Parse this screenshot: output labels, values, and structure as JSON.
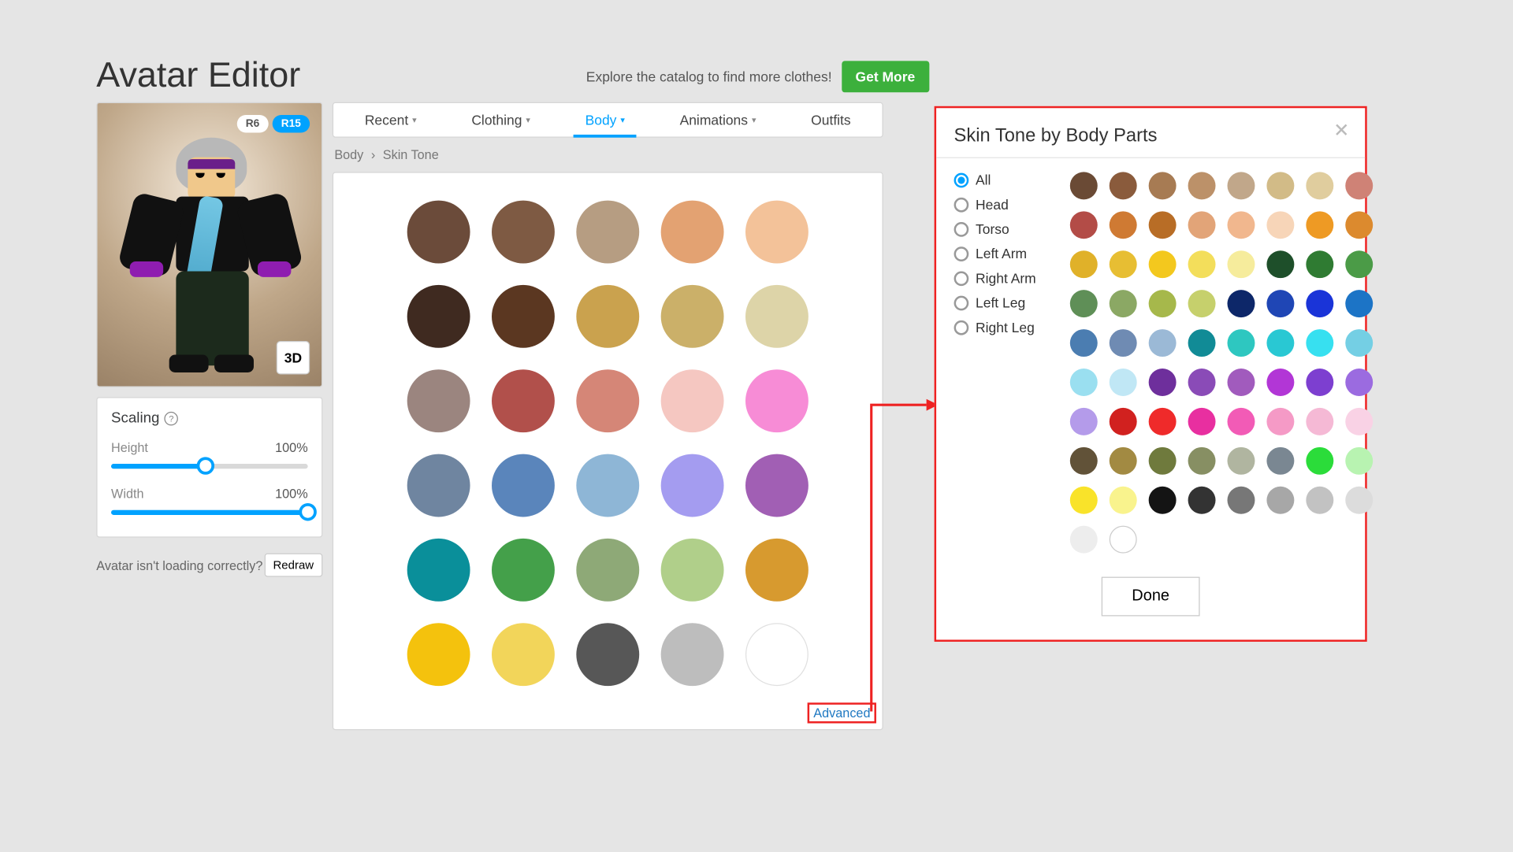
{
  "title": "Avatar Editor",
  "cta_text": "Explore the catalog to find more clothes!",
  "cta_button": "Get More",
  "rig": {
    "r6": "R6",
    "r15": "R15"
  },
  "three_d": "3D",
  "scaling": {
    "title": "Scaling",
    "height_label": "Height",
    "height_value": "100%",
    "height_fill_pct": 48,
    "width_label": "Width",
    "width_value": "100%",
    "width_fill_pct": 100
  },
  "not_loading_text": "Avatar isn't loading correctly?",
  "redraw_label": "Redraw",
  "tabs": {
    "recent": "Recent",
    "clothing": "Clothing",
    "body": "Body",
    "animations": "Animations",
    "outfits": "Outfits"
  },
  "breadcrumb": {
    "a": "Body",
    "b": "Skin Tone"
  },
  "advanced_label": "Advanced",
  "main_colors": [
    "#6b4b3a",
    "#7e5a43",
    "#b69d82",
    "#e3a272",
    "#f3c299",
    "#3f2a20",
    "#5b3721",
    "#caa24e",
    "#cbb069",
    "#ddd4a8",
    "#9b857f",
    "#b1504b",
    "#d58677",
    "#f5c7c1",
    "#f78cd6",
    "#6f85a0",
    "#5a85bb",
    "#8eb6d6",
    "#a49cf0",
    "#a15fb4",
    "#0a8f9a",
    "#44a04a",
    "#8ea977",
    "#b0cf8a",
    "#d79a2f",
    "#f4c20d",
    "#f2d55a",
    "#575757",
    "#bdbdbd",
    "#ffffff"
  ],
  "dialog": {
    "title": "Skin Tone by Body Parts",
    "done": "Done",
    "parts": [
      "All",
      "Head",
      "Torso",
      "Left Arm",
      "Right Arm",
      "Left Leg",
      "Right Leg"
    ],
    "selected_part": "All",
    "colors": [
      "#6a4a35",
      "#8a5b3c",
      "#a77b53",
      "#bc9169",
      "#c1a78a",
      "#d2bb87",
      "#e0cd9e",
      "#cf8276",
      "#b34c47",
      "#cf7a33",
      "#b86d26",
      "#e2a478",
      "#f1b78e",
      "#f7d5b8",
      "#ee9a24",
      "#dc8a2e",
      "#e0b129",
      "#e7be33",
      "#f3c81e",
      "#f3de5b",
      "#f6ec9c",
      "#1e4f2a",
      "#2f7b32",
      "#4b9b47",
      "#5f8f57",
      "#8ba864",
      "#a6b84b",
      "#c6d06c",
      "#0d2769",
      "#1f46b5",
      "#1a34d8",
      "#1c74c6",
      "#4b7db1",
      "#6f8bb3",
      "#9bb9d6",
      "#118b96",
      "#2ec7c0",
      "#29c8d3",
      "#37e0f0",
      "#74cfe4",
      "#9adff0",
      "#c0e7f5",
      "#6e2f9c",
      "#8a4bb7",
      "#a15bbd",
      "#b236d6",
      "#7d3fd0",
      "#9b6be0",
      "#b49bea",
      "#d1211f",
      "#ef2a2a",
      "#e82fa0",
      "#f25bb6",
      "#f59ac6",
      "#f5b9d5",
      "#f9d2e5",
      "#615238",
      "#a28a42",
      "#6f7a3d",
      "#878f63",
      "#b0b5a0",
      "#7a8792",
      "#2bdc3a",
      "#b8f3b1",
      "#f9e32a",
      "#f9f38d",
      "#141414",
      "#333333",
      "#777777",
      "#a7a7a7",
      "#c2c2c2",
      "#dcdcdc",
      "#ededed"
    ],
    "outline_slot": true
  }
}
